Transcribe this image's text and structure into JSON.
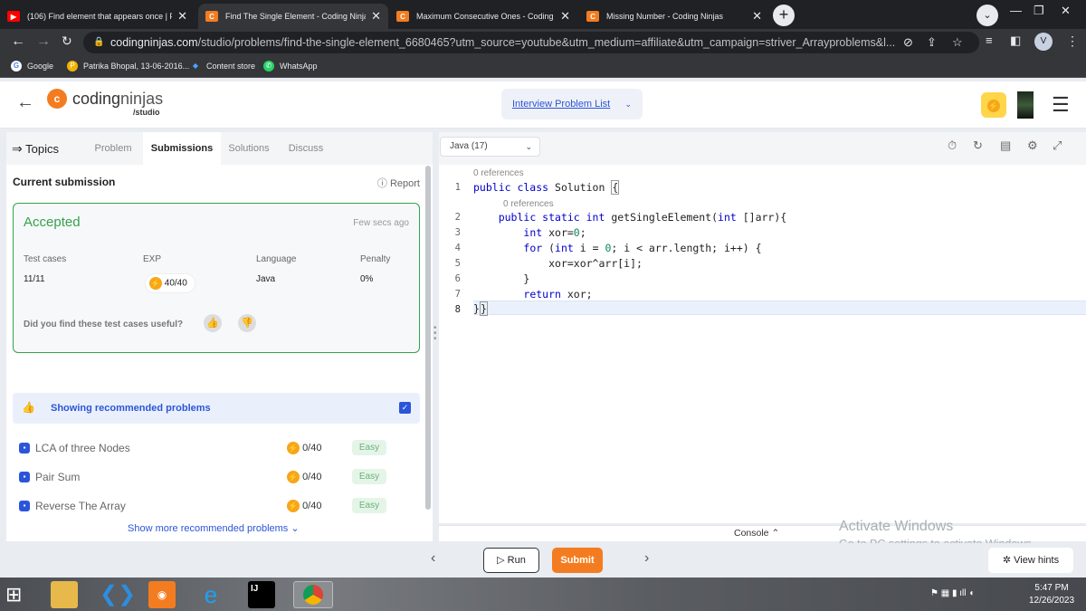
{
  "browser": {
    "tabs": [
      {
        "title": "(106) Find element that appears once | Find",
        "icon": "youtube-icon",
        "color": "#ff0000",
        "active": false
      },
      {
        "title": "Find The Single Element - Coding Ninjas",
        "icon": "codingninjas-icon",
        "color": "#f47c20",
        "active": true
      },
      {
        "title": "Maximum Consecutive Ones - Coding Ninja",
        "icon": "codingninjas-icon",
        "color": "#f47c20",
        "active": false
      },
      {
        "title": "Missing Number - Coding Ninjas",
        "icon": "codingninjas-icon",
        "color": "#f47c20",
        "active": false
      }
    ],
    "url_host": "codingninjas.com",
    "url_path": "/studio/problems/find-the-single-element_6680465?utm_source=youtube&utm_medium=affiliate&utm_campaign=striver_Arrayproblems&l...",
    "profile_initial": "V",
    "bookmarks": [
      "Google",
      "Patrika Bhopal, 13-06-2016...",
      "Content store",
      "WhatsApp"
    ]
  },
  "header": {
    "brand_a": "coding",
    "brand_b": "ninjas",
    "brand_sub": "/studio",
    "problem_list": "Interview Problem List"
  },
  "left": {
    "topics": "Topics",
    "tabs": [
      "Problem",
      "Submissions",
      "Solutions",
      "Discuss"
    ],
    "current_submission": "Current submission",
    "report": "Report",
    "status": "Accepted",
    "time": "Few secs ago",
    "cols": [
      "Test cases",
      "EXP",
      "Language",
      "Penalty"
    ],
    "vals": [
      "11/11",
      "40/40",
      "Java",
      "0%"
    ],
    "feedback": "Did you find these test cases useful?",
    "rec_title": "Showing recommended problems",
    "recommended": [
      {
        "name": "LCA of three Nodes",
        "exp": "0/40",
        "difficulty": "Easy"
      },
      {
        "name": "Pair Sum",
        "exp": "0/40",
        "difficulty": "Easy"
      },
      {
        "name": "Reverse The Array",
        "exp": "0/40",
        "difficulty": "Easy"
      }
    ],
    "show_more": "Show more recommended problems"
  },
  "editor": {
    "language": "Java (17)",
    "refs": "0 references",
    "lines": [
      "public class Solution {",
      "    public static int getSingleElement(int []arr){",
      "        int xor=0;",
      "        for (int i = 0; i < arr.length; i++) {",
      "            xor=xor^arr[i];",
      "        }",
      "        return xor;",
      "}}"
    ],
    "console": "Console"
  },
  "actions": {
    "run": "Run",
    "submit": "Submit",
    "hints": "View hints"
  },
  "watermark": {
    "line1": "Activate Windows",
    "line2": "Go to PC settings to activate Windows."
  },
  "clock": {
    "time": "5:47 PM",
    "date": "12/26/2023"
  }
}
